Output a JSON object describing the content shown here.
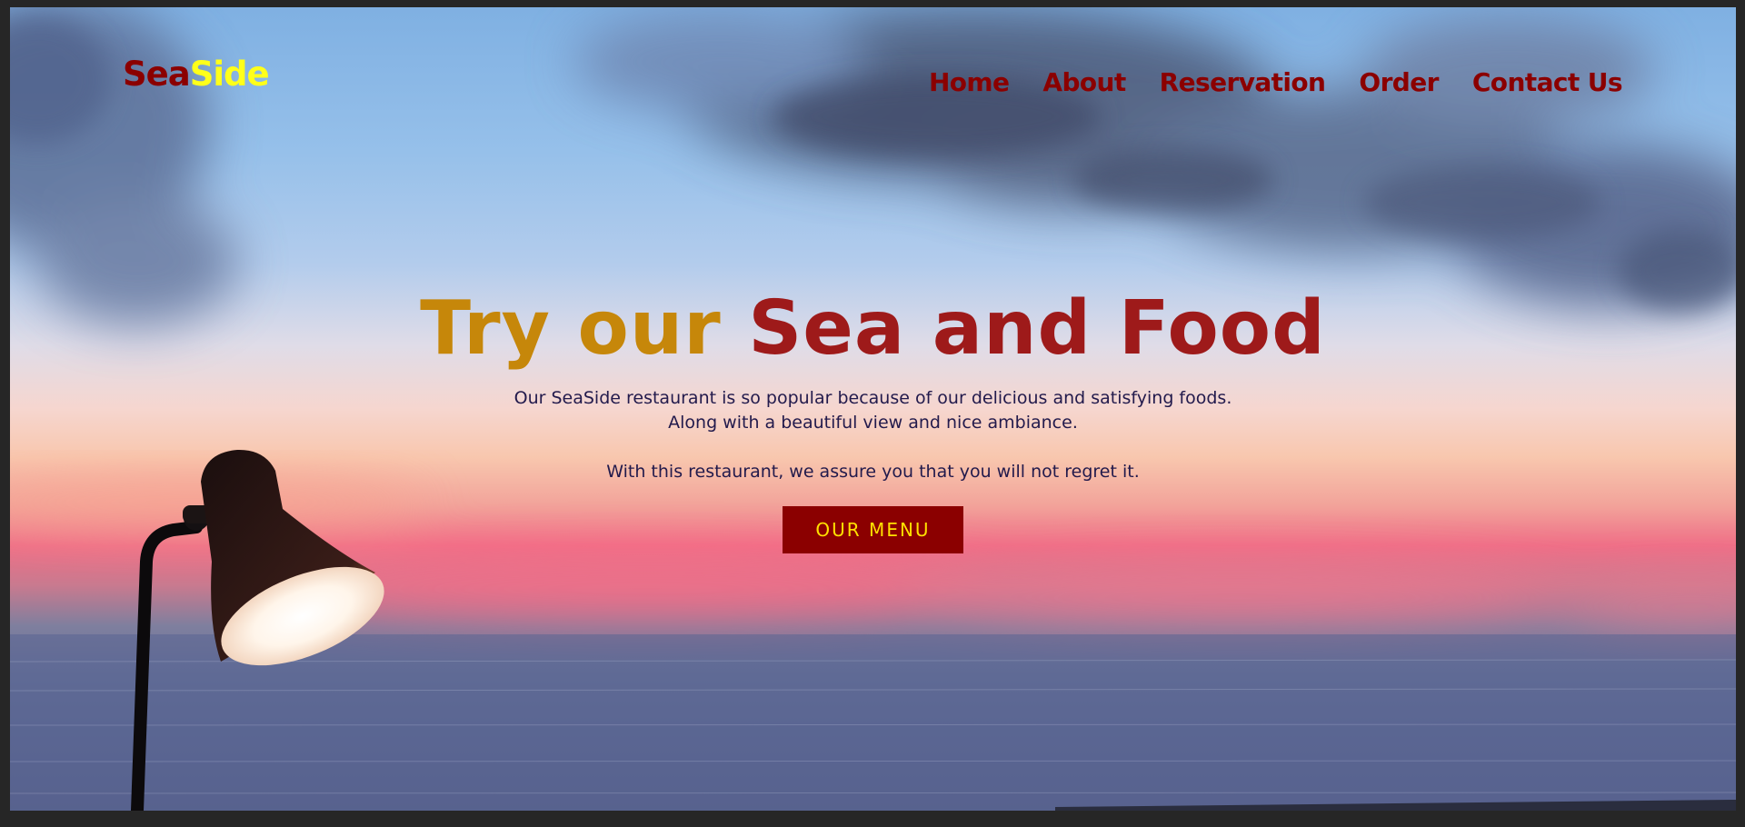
{
  "header": {
    "logo_part1": "Sea",
    "logo_part2": "Side",
    "nav": {
      "home": "Home",
      "about": "About",
      "reservation": "Reservation",
      "order": "Order",
      "contact": "Contact Us"
    }
  },
  "hero": {
    "title_part1": "Try our ",
    "title_part2": "Sea and Food",
    "line1": "Our SeaSide restaurant is so popular because of our delicious and satisfying foods.",
    "line2": "Along with a beautiful view and nice ambiance.",
    "line3": "With this restaurant, we assure you that you will not regret it.",
    "button_label": "OUR MENU"
  },
  "colors": {
    "brand_red": "#8b0000",
    "brand_yellow": "#ffff1a",
    "title_gold": "#c6870a",
    "title_red": "#9e1a1a",
    "text_dark": "#221a4c"
  }
}
